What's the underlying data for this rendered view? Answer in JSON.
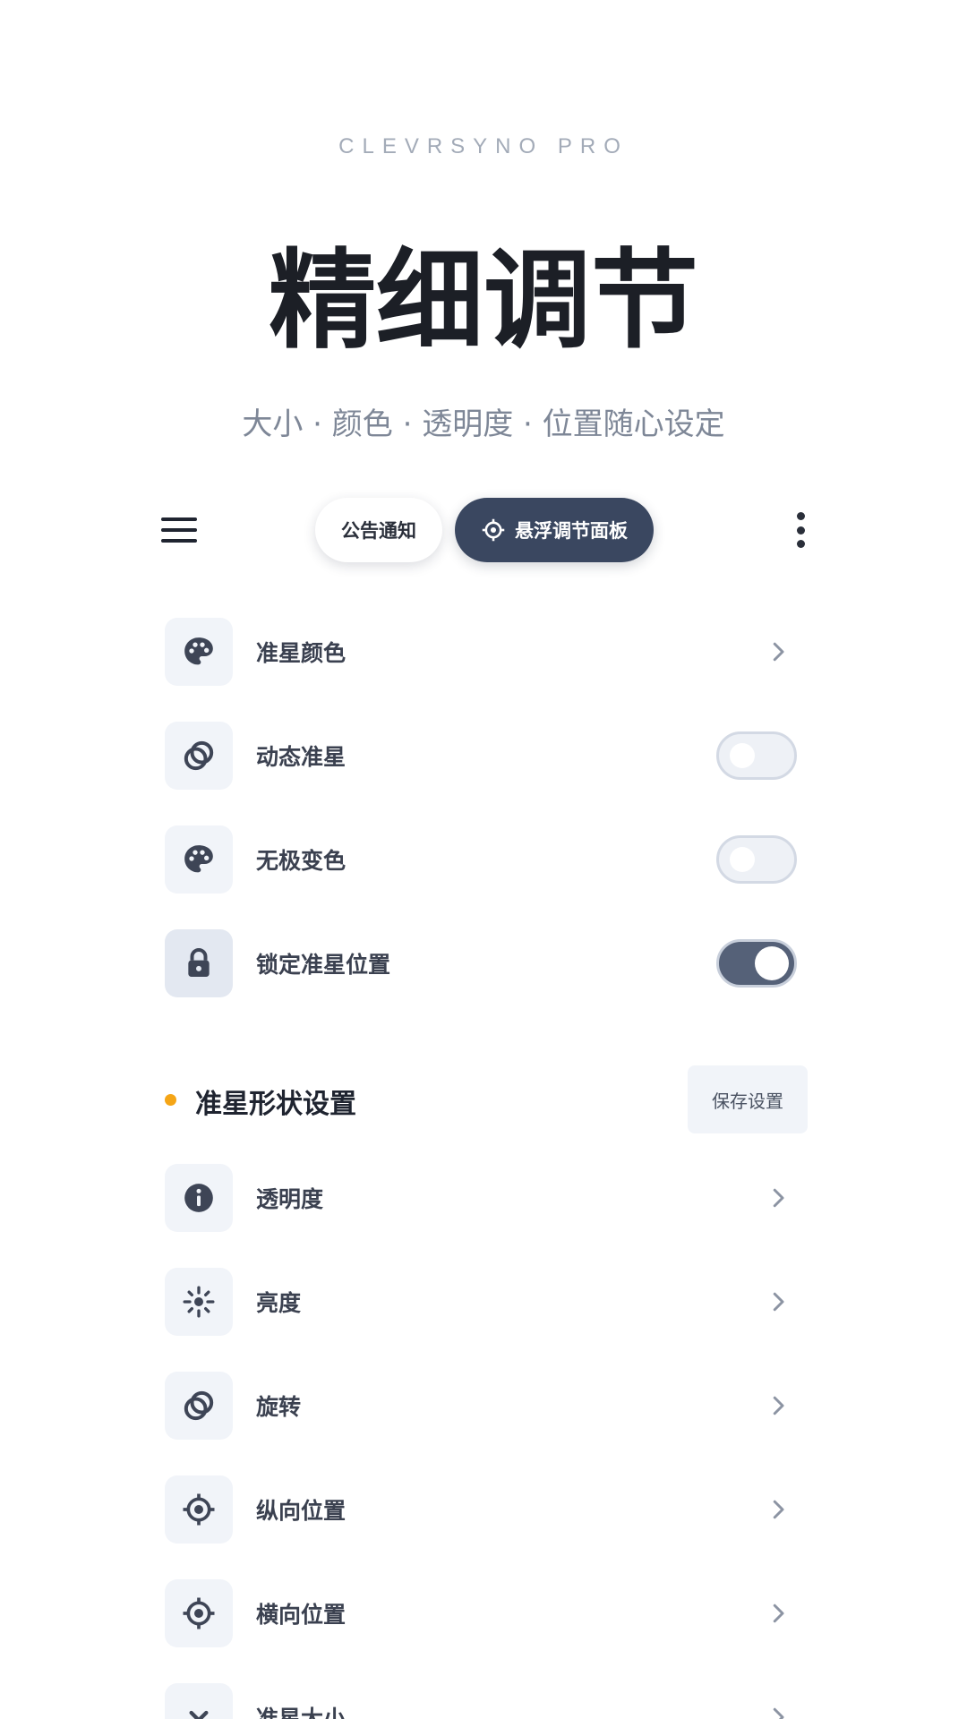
{
  "brand": "CLEVRSYNO PRO",
  "hero": {
    "title": "精细调节",
    "subtitle": "大小 · 颜色 · 透明度 · 位置随心设定"
  },
  "topbar": {
    "tabs": [
      {
        "label": "公告通知",
        "active": false
      },
      {
        "label": "悬浮调节面板",
        "active": true,
        "icon": "crosshair-icon"
      }
    ]
  },
  "settings_top": [
    {
      "label": "准星颜色",
      "icon": "palette-icon",
      "control": "chevron"
    },
    {
      "label": "动态准星",
      "icon": "rings-icon",
      "control": "toggle",
      "on": false
    },
    {
      "label": "无极变色",
      "icon": "palette-icon",
      "control": "toggle",
      "on": false
    },
    {
      "label": "锁定准星位置",
      "icon": "lock-icon",
      "control": "toggle",
      "on": true
    }
  ],
  "section": {
    "title": "准星形状设置",
    "save_label": "保存设置",
    "dot_color": "#f5a516"
  },
  "settings_shape": [
    {
      "label": "透明度",
      "icon": "info-icon",
      "control": "chevron"
    },
    {
      "label": "亮度",
      "icon": "brightness-icon",
      "control": "chevron"
    },
    {
      "label": "旋转",
      "icon": "rings-icon",
      "control": "chevron"
    },
    {
      "label": "纵向位置",
      "icon": "crosshair-icon",
      "control": "chevron"
    },
    {
      "label": "横向位置",
      "icon": "crosshair-icon",
      "control": "chevron"
    },
    {
      "label": "准星大小",
      "icon": "chevron-down-icon",
      "control": "chevron"
    }
  ],
  "colors": {
    "accent_dark": "#3a4760",
    "toggle_on": "#556178",
    "dot": "#f5a516"
  }
}
